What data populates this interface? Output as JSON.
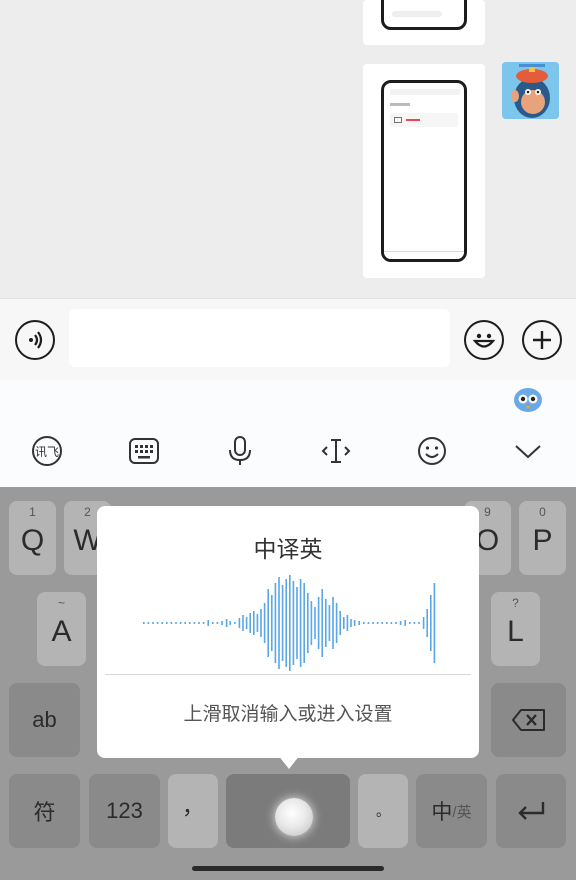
{
  "popup": {
    "title": "中译英",
    "hint": "上滑取消输入或进入设置"
  },
  "keys": {
    "q": {
      "main": "Q",
      "sub": "1"
    },
    "w": {
      "main": "W",
      "sub": "2"
    },
    "o": {
      "main": "O",
      "sub": "9"
    },
    "p": {
      "main": "P",
      "sub": "0"
    },
    "a": {
      "main": "A",
      "sub": "~"
    },
    "l": {
      "main": "L",
      "sub": "?"
    },
    "shift": "ab",
    "symbol": "符",
    "num": "123",
    "comma": "，",
    "period": "。",
    "lang_main": "中",
    "lang_sub": "/英"
  },
  "icons": {
    "voice": "voice-icon",
    "emoji": "emoji-icon",
    "plus": "plus-icon"
  },
  "colors": {
    "waveform": "#5aa6e6",
    "keyboard_bg": "#9a9a9a"
  }
}
